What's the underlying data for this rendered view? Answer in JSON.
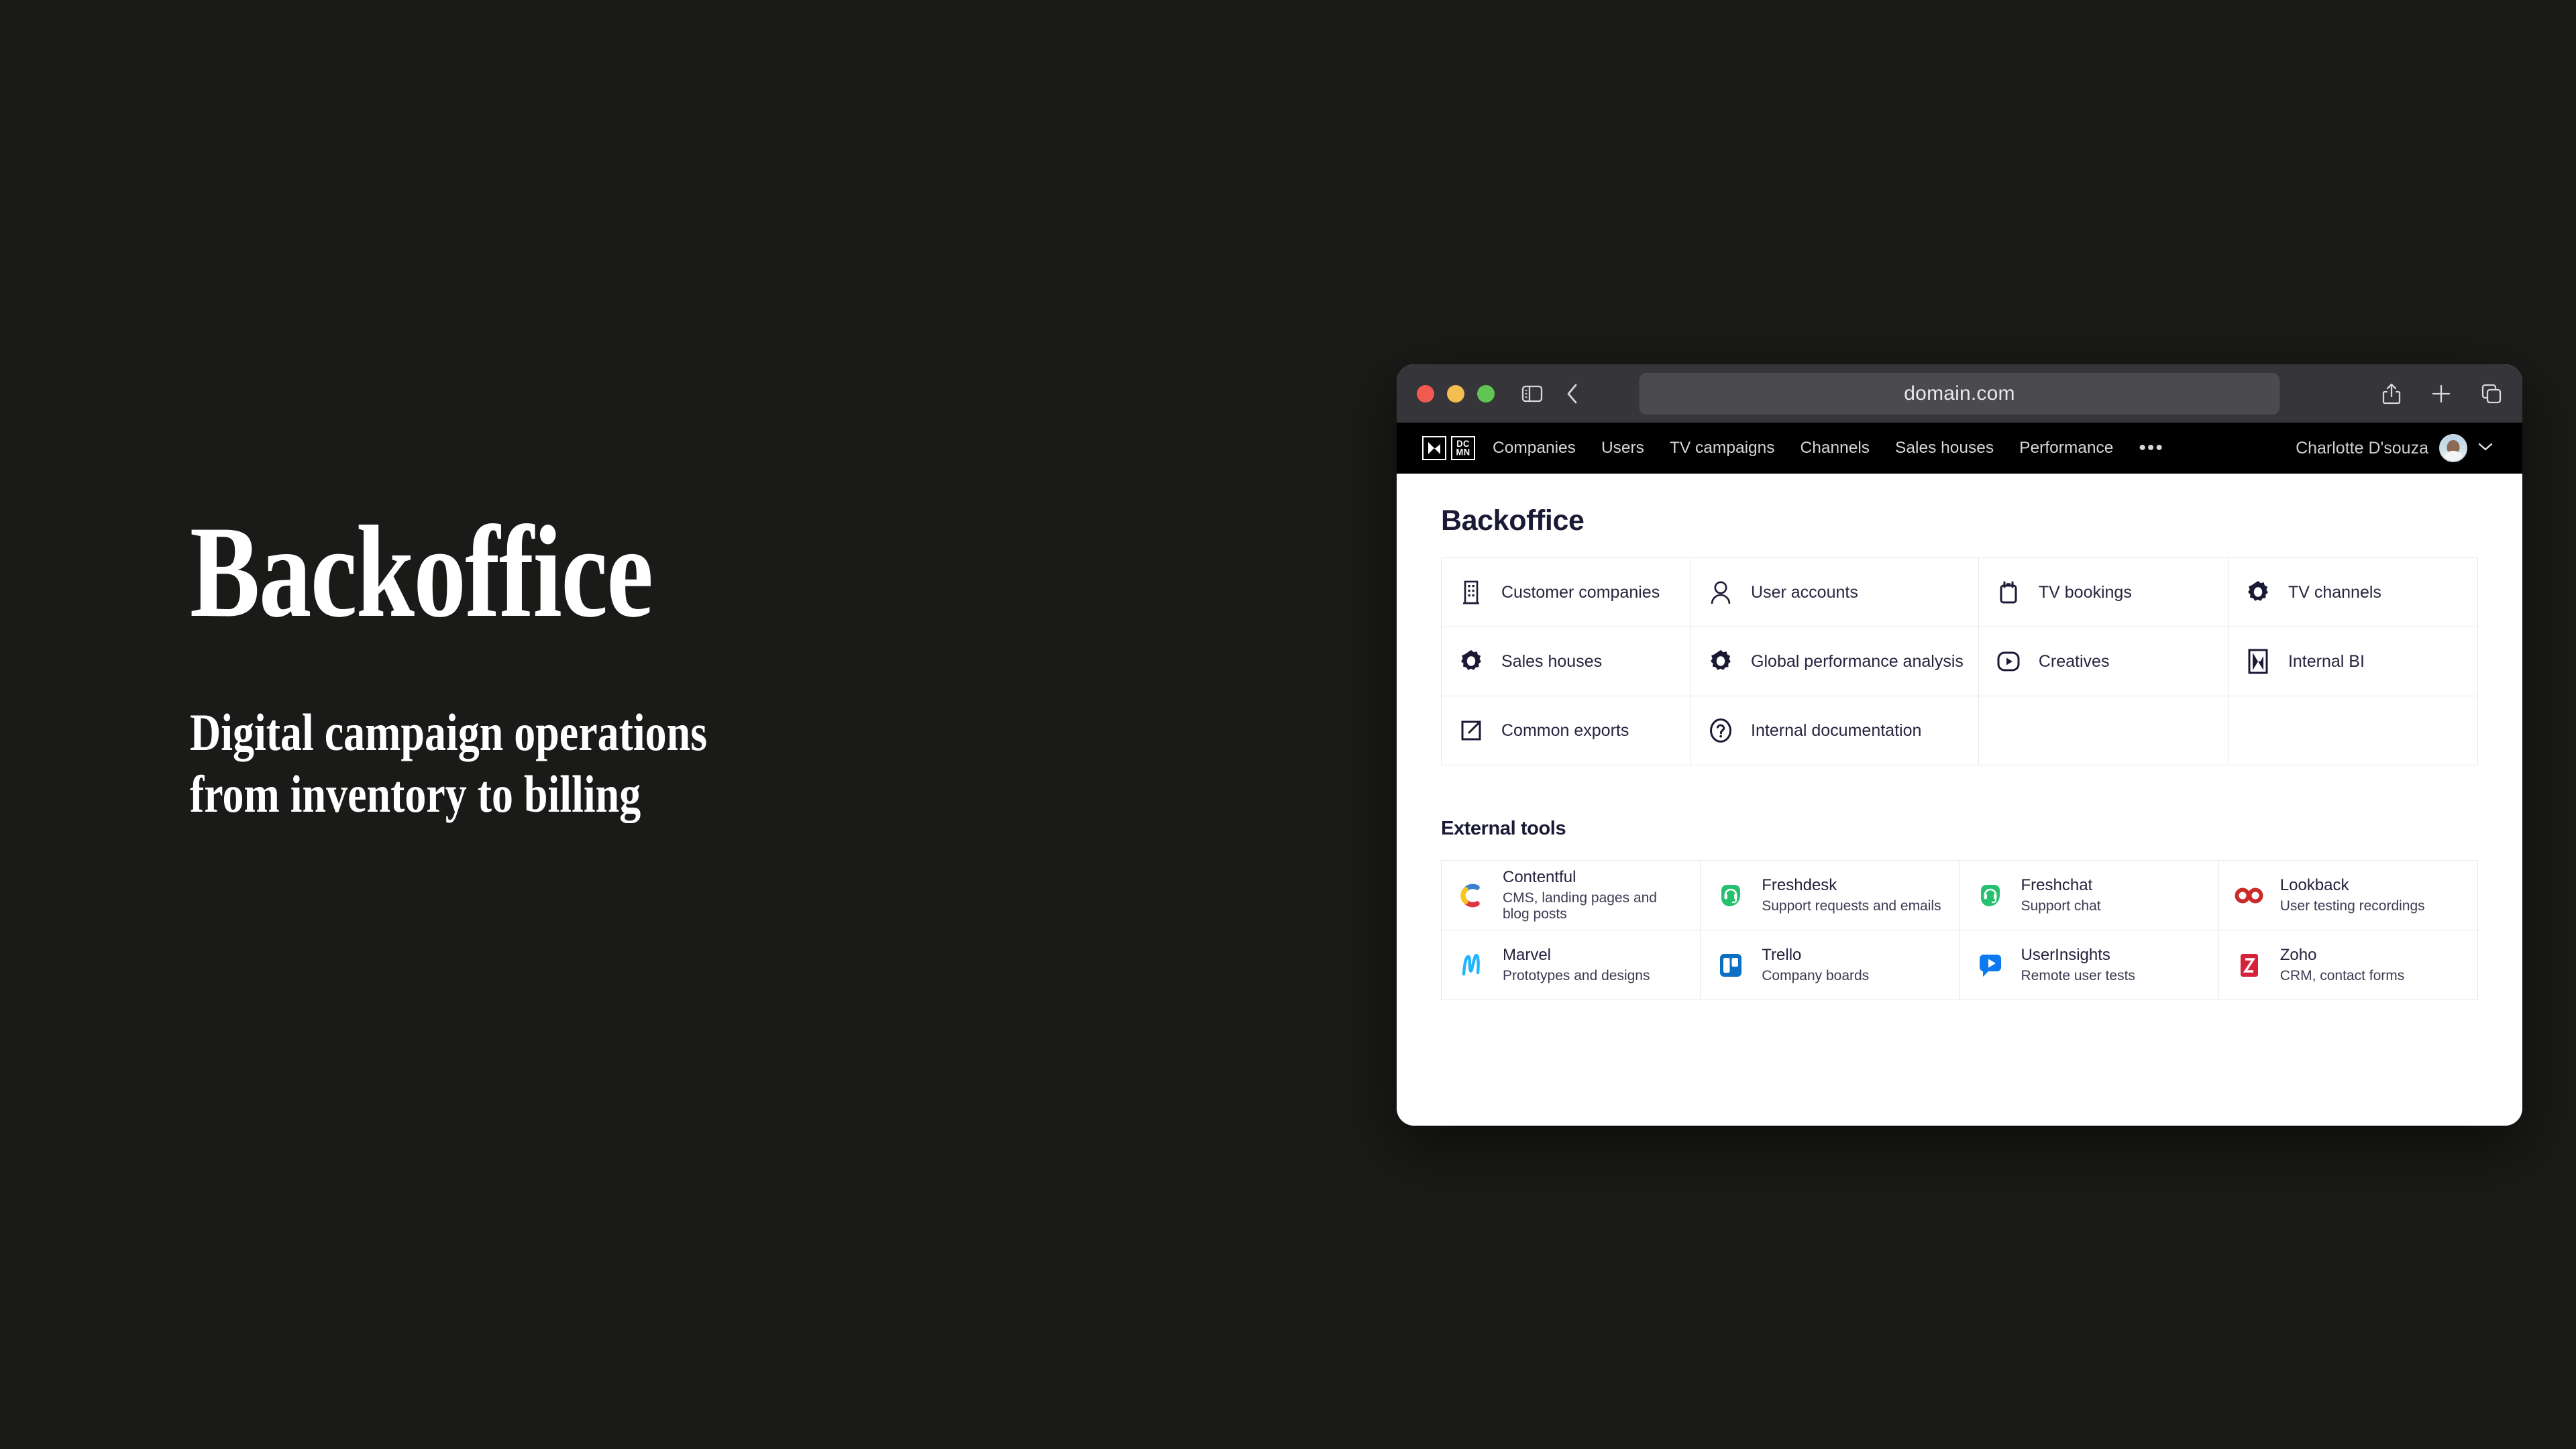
{
  "hero": {
    "title": "Backoffice",
    "subtitle": "Digital campaign operations from inventory to billing"
  },
  "browser": {
    "url": "domain.com",
    "traffic_lights": [
      "close",
      "minimize",
      "zoom"
    ],
    "toolbar_icons": {
      "sidebar": "sidebar-icon",
      "back": "back-chevron-icon",
      "share": "share-icon",
      "new_tab": "plus-icon",
      "tab_overview": "tab-overview-icon"
    }
  },
  "appnav": {
    "brand": {
      "mark": "x-mark-icon",
      "letters": "DC\nMN"
    },
    "items": [
      {
        "label": "Companies"
      },
      {
        "label": "Users"
      },
      {
        "label": "TV campaigns"
      },
      {
        "label": "Channels"
      },
      {
        "label": "Sales houses"
      },
      {
        "label": "Performance"
      }
    ],
    "more": "•••",
    "user": {
      "name": "Charlotte D'souza",
      "avatar": "user-avatar",
      "chevron": "chevron-down-icon"
    }
  },
  "main": {
    "title": "Backoffice",
    "tiles": [
      {
        "label": "Customer companies",
        "icon": "building-icon"
      },
      {
        "label": "User accounts",
        "icon": "person-icon"
      },
      {
        "label": "TV bookings",
        "icon": "notepad-icon"
      },
      {
        "label": "TV channels",
        "icon": "gear-icon"
      },
      {
        "label": "Sales houses",
        "icon": "gear-icon"
      },
      {
        "label": "Global performance analysis",
        "icon": "gear-icon"
      },
      {
        "label": "Creatives",
        "icon": "play-icon"
      },
      {
        "label": "Internal BI",
        "icon": "x-mark-boxed-icon"
      },
      {
        "label": "Common exports",
        "icon": "external-link-icon"
      },
      {
        "label": "Internal documentation",
        "icon": "question-circle-icon"
      },
      {
        "label": "",
        "icon": ""
      },
      {
        "label": "",
        "icon": ""
      }
    ]
  },
  "external": {
    "title": "External tools",
    "tools": [
      {
        "name": "Contentful",
        "desc": "CMS, landing pages and blog posts",
        "icon": "contentful-logo",
        "color": "#2478CC"
      },
      {
        "name": "Freshdesk",
        "desc": "Support requests and emails",
        "icon": "freshdesk-logo",
        "color": "#25C16F"
      },
      {
        "name": "Freshchat",
        "desc": "Support chat",
        "icon": "freshchat-logo",
        "color": "#25C16F"
      },
      {
        "name": "Lookback",
        "desc": "User testing recordings",
        "icon": "lookback-logo",
        "color": "#C92A2A"
      },
      {
        "name": "Marvel",
        "desc": "Prototypes and designs",
        "icon": "marvel-logo",
        "color": "#1FB6FF"
      },
      {
        "name": "Trello",
        "desc": "Company boards",
        "icon": "trello-logo",
        "color": "#0B6FC4"
      },
      {
        "name": "UserInsights",
        "desc": "Remote user tests",
        "icon": "userinsights-logo",
        "color": "#0B7AF0"
      },
      {
        "name": "Zoho",
        "desc": "CRM, contact forms",
        "icon": "zoho-logo",
        "color": "#D6213B"
      }
    ]
  },
  "colors": {
    "page_background": "#1a1a18",
    "nav_background": "#000000",
    "toolbar_background": "#35353a",
    "heading": "#1b1a35",
    "grid_border": "#e7e7ea"
  }
}
